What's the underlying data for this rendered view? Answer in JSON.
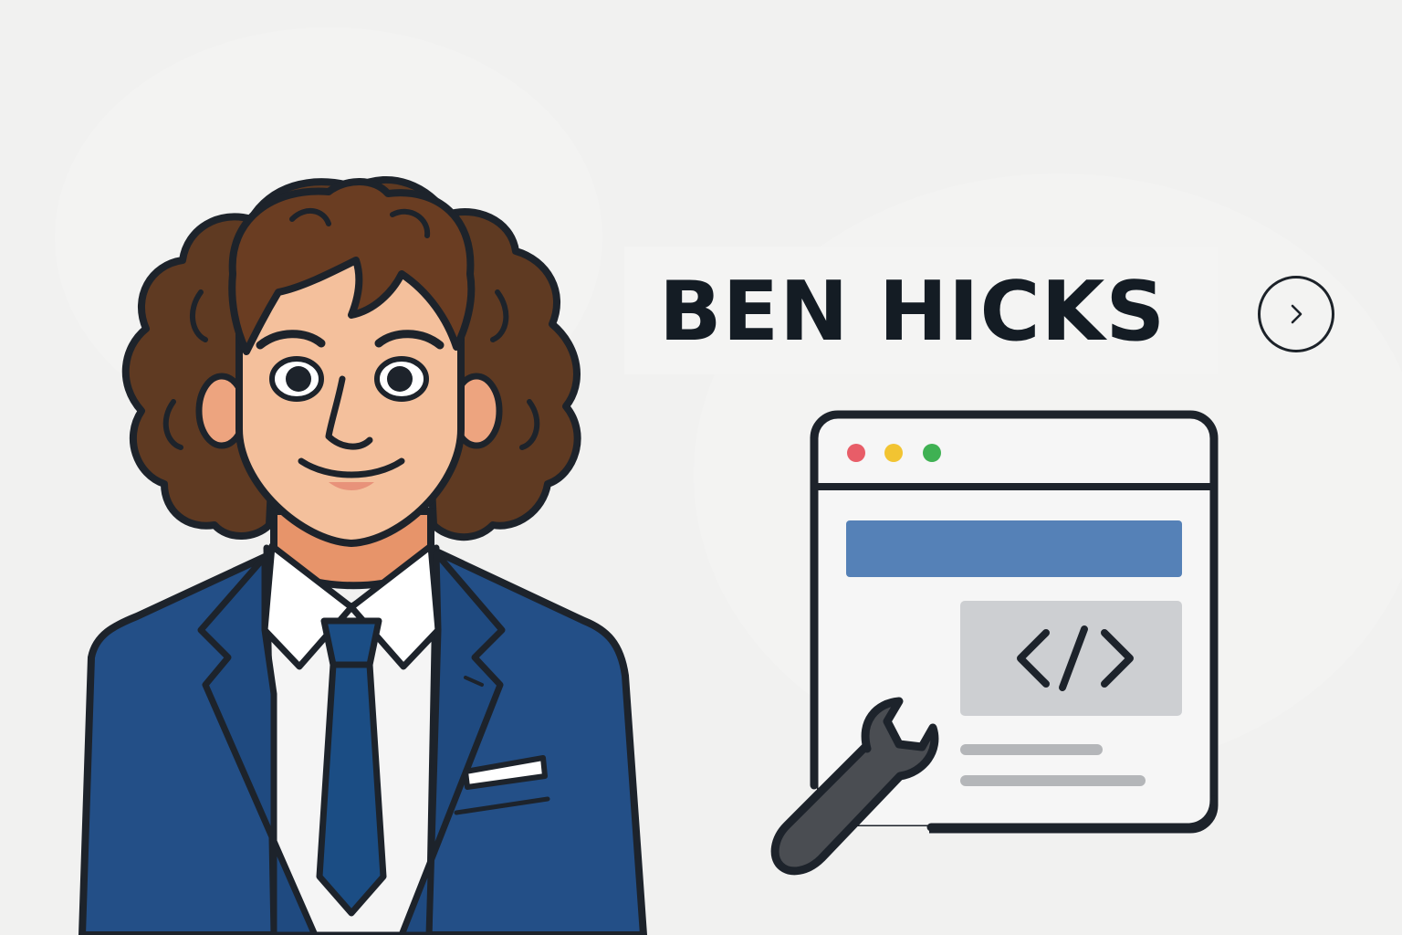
{
  "header": {
    "title": "BEN HICKS",
    "next_icon": "chevron-right-icon"
  },
  "illustration": {
    "person_icon": "person-avatar-illustration",
    "browser_icon": "browser-window-icon",
    "code_icon": "code-brackets-icon",
    "wrench_icon": "wrench-icon",
    "dot_colors": [
      "#e85d68",
      "#f2c432",
      "#3fb153"
    ],
    "suit_color": "#234f87",
    "hair_color": "#6a3d22",
    "browser_bar_color": "#5581b7"
  }
}
